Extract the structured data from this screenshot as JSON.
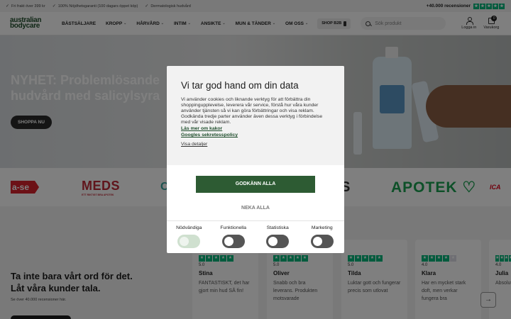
{
  "topbar": {
    "usps": [
      "Fri frakt över 399 kr",
      "100% Nöjdhetsgaranti (100 dagars öppet köp)",
      "Dermatologisk hudvård"
    ],
    "reviews_label": "+40.000 recensioner"
  },
  "header": {
    "logo_line1": "australian",
    "logo_line2": "bodycare",
    "nav": [
      {
        "label": "BÄSTSÄLJARE",
        "dropdown": false
      },
      {
        "label": "KROPP",
        "dropdown": true
      },
      {
        "label": "HÅRVÅRD",
        "dropdown": true
      },
      {
        "label": "INTIM",
        "dropdown": true
      },
      {
        "label": "ANSIKTE",
        "dropdown": true
      },
      {
        "label": "MUN & TÄNDER",
        "dropdown": true
      },
      {
        "label": "OM OSS",
        "dropdown": true
      }
    ],
    "shop_b2b": "SHOP B2B",
    "search_placeholder": "Sök produkt",
    "login_label": "Logga in",
    "cart_label": "Varukorg",
    "cart_count": "0"
  },
  "hero": {
    "headline_line1": "NYHET: Problemlösande",
    "headline_line2": "hudvård med salicylsyra",
    "cta": "SHOPPA NU"
  },
  "brands": {
    "case": "a-se",
    "meds": "MEDS",
    "meds_tag": "ETT RIKTIGT BRA APOTEK",
    "frag1": "C",
    "frag2": "S",
    "apotek": "APOTEK",
    "ica": "ICA"
  },
  "reviews": {
    "title_line1": "Ta inte bara vårt ord för det.",
    "title_line2": "Låt våra kunder tala.",
    "subtitle": "Se över 40.000 recensioner här.",
    "cards": [
      {
        "score": "5.0",
        "rating": 5,
        "name": "Stina",
        "text": "FANTASTISKT, det har gjort min hud SÅ fin!"
      },
      {
        "score": "5.0",
        "rating": 5,
        "name": "Oliver",
        "text": "Snabb och bra leverans. Produkten motsvarade"
      },
      {
        "score": "5.0",
        "rating": 5,
        "name": "Tilda",
        "text": "Luktar gott och fungerar precis som utlovat"
      },
      {
        "score": "4.0",
        "rating": 4,
        "name": "Klara",
        "text": "Har en mycket stark doft, men verkar fungera bra"
      },
      {
        "score": "4.0",
        "rating": 4,
        "name": "Julia",
        "text": "Absolut av hud"
      }
    ],
    "next_icon": "arrow-right-icon"
  },
  "consent": {
    "title": "Vi tar god hand om din data",
    "body": "Vi använder cookies och liknande verktyg för att förbättra din shoppingupplevelse, leverera vår service, förstå hur våra kunder använder tjänsten så vi kan göra förbättringar och visa reklam. Godkända tredje parter använder även dessa verktyg i förbindelse med vår visade reklam.",
    "link1": "Läs mer om kakor",
    "link2": "Googles sekretesspolicy",
    "details": "Visa detaljer",
    "accept": "GODKÄNN ALLA",
    "deny": "NEKA ALLA",
    "toggles": [
      {
        "label": "Nödvändiga",
        "on": true,
        "locked": true
      },
      {
        "label": "Funktionella",
        "on": false,
        "locked": false
      },
      {
        "label": "Statistiska",
        "on": false,
        "locked": false
      },
      {
        "label": "Marketing",
        "on": false,
        "locked": false
      }
    ]
  },
  "colors": {
    "brand_green": "#1e4d2b",
    "accept_green": "#2d5b33",
    "trustpilot_green": "#00b67a"
  }
}
